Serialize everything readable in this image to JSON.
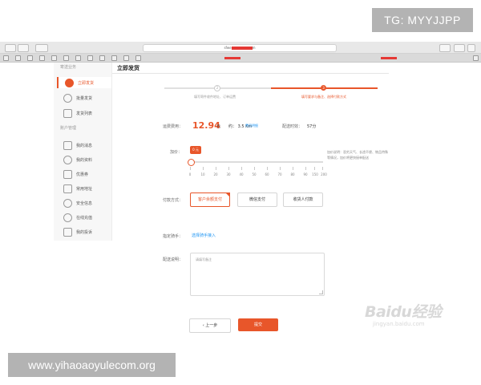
{
  "overlay": {
    "top_tag": "TG: MYYJJPP",
    "bottom_url": "www.yihaoaoyulecom.org"
  },
  "browser": {
    "address_prefix": "sfwe",
    "address_suffix": "m"
  },
  "sidebar": {
    "section_top": "寄送业务",
    "items_top": [
      {
        "label": "立即发货",
        "active": true,
        "icon": "truck-icon"
      },
      {
        "label": "批量发货",
        "active": false,
        "icon": "boxes-icon"
      },
      {
        "label": "发货列表",
        "active": false,
        "icon": "list-icon"
      }
    ],
    "section_account": "账户管理",
    "items_account": [
      {
        "label": "我的消息",
        "icon": "message-icon"
      },
      {
        "label": "我的资料",
        "icon": "profile-icon"
      },
      {
        "label": "优惠券",
        "icon": "coupon-icon"
      },
      {
        "label": "常用地址",
        "icon": "address-icon"
      },
      {
        "label": "安全信息",
        "icon": "shield-icon"
      },
      {
        "label": "在线充值",
        "icon": "recharge-icon"
      },
      {
        "label": "我的投诉",
        "icon": "complaint-icon"
      }
    ]
  },
  "main": {
    "title": "立即发货",
    "steps": [
      {
        "num": "2",
        "label": "填写寄件收件地址、订单运费"
      },
      {
        "num": "3",
        "label": "填写要求与备注、选择付款方式"
      }
    ],
    "fee_label": "运费费用：",
    "fee_value": "12.94",
    "fee_unit": "元",
    "distance": "约： 3.5 Km",
    "detail_link": "费用明细",
    "dist_label": "配送时效：",
    "dist_value": "57分",
    "tip_label": "加价：",
    "tip_bubble": "0 元",
    "slider_scale": [
      "0",
      "10",
      "20",
      "30",
      "40",
      "50",
      "60",
      "70",
      "80",
      "90",
      "150",
      "200"
    ],
    "tip_value": 0,
    "tip_note": "加价说明：恶劣天气、长途不便、物品特殊等情况，加价将更快接单配送",
    "pay_label": "付款方式：",
    "pay_options": [
      {
        "label": "客户余额支付",
        "selected": true
      },
      {
        "label": "微信支付",
        "selected": false
      },
      {
        "label": "收货人付款",
        "selected": false
      }
    ],
    "payee_label": "指定骑手：",
    "payee_link": "选择骑手接入",
    "note_label": "配送说明：",
    "note_placeholder": "请填写备注",
    "prev_button": "上一步",
    "next_button": "提交"
  },
  "watermark": {
    "logo": "Baidu经验",
    "sub": "jingyan.baidu.com"
  }
}
